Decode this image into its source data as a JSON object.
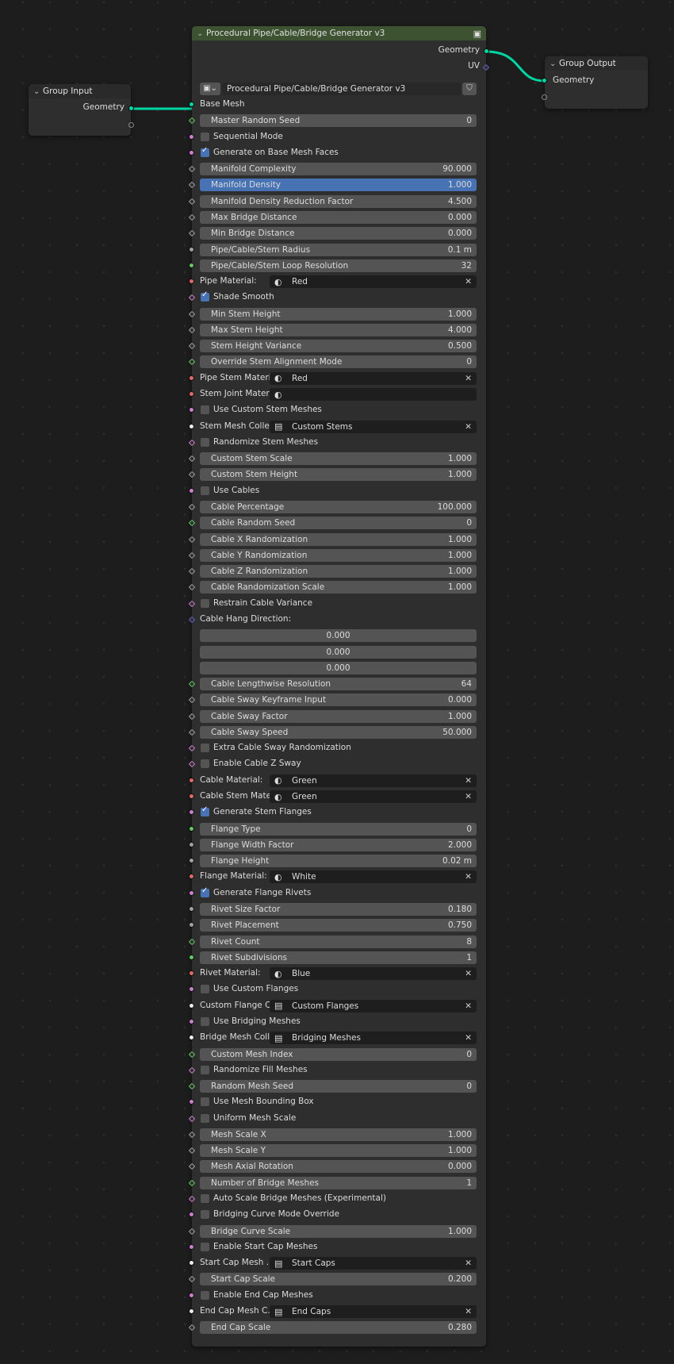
{
  "group_input": {
    "title": "Group Input",
    "outputs": [
      "Geometry"
    ]
  },
  "group_output": {
    "title": "Group Output",
    "inputs": [
      "Geometry"
    ]
  },
  "main_node": {
    "title": "Procedural Pipe/Cable/Bridge Generator v3",
    "tree_name": "Procedural Pipe/Cable/Bridge Generator v3",
    "outputs": [
      "Geometry",
      "UV"
    ],
    "rows": [
      {
        "kind": "plain",
        "label": "Base Mesh",
        "socket": "c-geo",
        "shape": "circle",
        "name": "base-mesh-socket-row"
      },
      {
        "kind": "field",
        "label": "Master Random Seed",
        "value": "0",
        "socket": "c-green",
        "shape": "diamond"
      },
      {
        "kind": "check",
        "label": "Sequential Mode",
        "checked": false,
        "socket": "c-pink",
        "shape": "circle"
      },
      {
        "kind": "check",
        "label": "Generate on Base Mesh Faces",
        "checked": true,
        "socket": "c-pink",
        "shape": "circle"
      },
      {
        "kind": "field",
        "label": "Manifold Complexity",
        "value": "90.000",
        "socket": "c-gray",
        "shape": "diamond"
      },
      {
        "kind": "field",
        "label": "Manifold Density",
        "value": "1.000",
        "socket": "c-gray",
        "shape": "diamond",
        "active": true
      },
      {
        "kind": "field",
        "label": "Manifold Density Reduction Factor",
        "value": "4.500",
        "socket": "c-gray",
        "shape": "diamond"
      },
      {
        "kind": "field",
        "label": "Max Bridge Distance",
        "value": "0.000",
        "socket": "c-gray",
        "shape": "diamond"
      },
      {
        "kind": "field",
        "label": "Min Bridge Distance",
        "value": "0.000",
        "socket": "c-gray",
        "shape": "diamond"
      },
      {
        "kind": "field",
        "label": "Pipe/Cable/Stem Radius",
        "value": "0.1 m",
        "socket": "c-gray",
        "shape": "circle"
      },
      {
        "kind": "field",
        "label": "Pipe/Cable/Stem Loop Resolution",
        "value": "32",
        "socket": "c-green",
        "shape": "circle"
      },
      {
        "kind": "select",
        "label": "Pipe Material:",
        "value": "Red",
        "icon": "material",
        "close": true,
        "socket": "c-red",
        "shape": "circle"
      },
      {
        "kind": "check",
        "label": "Shade Smooth",
        "checked": true,
        "socket": "c-pink",
        "shape": "diamond"
      },
      {
        "kind": "field",
        "label": "Min Stem Height",
        "value": "1.000",
        "socket": "c-gray",
        "shape": "diamond"
      },
      {
        "kind": "field",
        "label": "Max Stem Height",
        "value": "4.000",
        "socket": "c-gray",
        "shape": "diamond"
      },
      {
        "kind": "field",
        "label": "Stem Height Variance",
        "value": "0.500",
        "socket": "c-gray",
        "shape": "diamond"
      },
      {
        "kind": "field",
        "label": "Override Stem Alignment Mode",
        "value": "0",
        "socket": "c-green",
        "shape": "diamond"
      },
      {
        "kind": "select",
        "label": "Pipe Stem Materi",
        "value": "Red",
        "icon": "material",
        "close": true,
        "socket": "c-red",
        "shape": "circle"
      },
      {
        "kind": "select",
        "label": "Stem Joint Materi",
        "value": "",
        "icon": "material",
        "close": false,
        "socket": "c-red",
        "shape": "circle"
      },
      {
        "kind": "check",
        "label": "Use Custom Stem Meshes",
        "checked": false,
        "socket": "c-pink",
        "shape": "circle"
      },
      {
        "kind": "select",
        "label": "Stem Mesh Colle...",
        "value": "Custom Stems",
        "icon": "collection",
        "close": true,
        "socket": "c-white",
        "shape": "circle"
      },
      {
        "kind": "check",
        "label": "Randomize Stem Meshes",
        "checked": false,
        "socket": "c-pink",
        "shape": "diamond"
      },
      {
        "kind": "field",
        "label": "Custom Stem Scale",
        "value": "1.000",
        "socket": "c-gray",
        "shape": "diamond"
      },
      {
        "kind": "field",
        "label": "Custom Stem Height",
        "value": "1.000",
        "socket": "c-gray",
        "shape": "diamond"
      },
      {
        "kind": "check",
        "label": "Use Cables",
        "checked": false,
        "socket": "c-pink",
        "shape": "circle"
      },
      {
        "kind": "field",
        "label": "Cable Percentage",
        "value": "100.000",
        "socket": "c-gray",
        "shape": "diamond"
      },
      {
        "kind": "field",
        "label": "Cable Random Seed",
        "value": "0",
        "socket": "c-green",
        "shape": "diamond"
      },
      {
        "kind": "field",
        "label": "Cable X Randomization",
        "value": "1.000",
        "socket": "c-gray",
        "shape": "diamond"
      },
      {
        "kind": "field",
        "label": "Cable Y Randomization",
        "value": "1.000",
        "socket": "c-gray",
        "shape": "diamond"
      },
      {
        "kind": "field",
        "label": "Cable Z Randomization",
        "value": "1.000",
        "socket": "c-gray",
        "shape": "diamond"
      },
      {
        "kind": "field",
        "label": "Cable Randomization Scale",
        "value": "1.000",
        "socket": "c-gray",
        "shape": "diamond"
      },
      {
        "kind": "check",
        "label": "Restrain Cable Variance",
        "checked": false,
        "socket": "c-pink",
        "shape": "diamond"
      },
      {
        "kind": "plain",
        "label": "Cable Hang Direction:",
        "socket": "c-blue",
        "shape": "diamond",
        "name": "cable-hang-direction-label"
      },
      {
        "kind": "vec",
        "value": "0.000",
        "name": "cable-hang-direction-x"
      },
      {
        "kind": "vec",
        "value": "0.000",
        "name": "cable-hang-direction-y"
      },
      {
        "kind": "vec",
        "value": "0.000",
        "name": "cable-hang-direction-z"
      },
      {
        "kind": "field",
        "label": "Cable Lengthwise Resolution",
        "value": "64",
        "socket": "c-green",
        "shape": "diamond"
      },
      {
        "kind": "field",
        "label": "Cable Sway Keyframe Input",
        "value": "0.000",
        "socket": "c-gray",
        "shape": "diamond"
      },
      {
        "kind": "field",
        "label": "Cable Sway Factor",
        "value": "1.000",
        "socket": "c-gray",
        "shape": "diamond"
      },
      {
        "kind": "field",
        "label": "Cable Sway Speed",
        "value": "50.000",
        "socket": "c-gray",
        "shape": "diamond"
      },
      {
        "kind": "check",
        "label": "Extra Cable Sway Randomization",
        "checked": false,
        "socket": "c-pink",
        "shape": "diamond"
      },
      {
        "kind": "check",
        "label": "Enable Cable Z Sway",
        "checked": false,
        "socket": "c-pink",
        "shape": "diamond"
      },
      {
        "kind": "select",
        "label": "Cable Material:",
        "value": "Green",
        "icon": "material",
        "close": true,
        "socket": "c-red",
        "shape": "circle"
      },
      {
        "kind": "select",
        "label": "Cable Stem Mate",
        "value": "Green",
        "icon": "material",
        "close": true,
        "socket": "c-red",
        "shape": "circle"
      },
      {
        "kind": "check",
        "label": "Generate Stem Flanges",
        "checked": true,
        "socket": "c-pink",
        "shape": "circle"
      },
      {
        "kind": "field",
        "label": "Flange Type",
        "value": "0",
        "socket": "c-green",
        "shape": "circle"
      },
      {
        "kind": "field",
        "label": "Flange Width Factor",
        "value": "2.000",
        "socket": "c-gray",
        "shape": "circle"
      },
      {
        "kind": "field",
        "label": "Flange Height",
        "value": "0.02 m",
        "socket": "c-gray",
        "shape": "circle"
      },
      {
        "kind": "select",
        "label": "Flange Material:",
        "value": "White",
        "icon": "material",
        "close": true,
        "socket": "c-red",
        "shape": "circle"
      },
      {
        "kind": "check",
        "label": "Generate Flange Rivets",
        "checked": true,
        "socket": "c-pink",
        "shape": "circle"
      },
      {
        "kind": "field",
        "label": "Rivet Size Factor",
        "value": "0.180",
        "socket": "c-gray",
        "shape": "circle"
      },
      {
        "kind": "field",
        "label": "Rivet Placement",
        "value": "0.750",
        "socket": "c-gray",
        "shape": "circle"
      },
      {
        "kind": "field",
        "label": "Rivet Count",
        "value": "8",
        "socket": "c-green",
        "shape": "diamond"
      },
      {
        "kind": "field",
        "label": "Rivet Subdivisions",
        "value": "1",
        "socket": "c-green",
        "shape": "circle"
      },
      {
        "kind": "select",
        "label": "Rivet Material:",
        "value": "Blue",
        "icon": "material",
        "close": true,
        "socket": "c-red",
        "shape": "circle"
      },
      {
        "kind": "check",
        "label": "Use Custom Flanges",
        "checked": false,
        "socket": "c-pink",
        "shape": "circle"
      },
      {
        "kind": "select",
        "label": "Custom Flange C",
        "value": "Custom Flanges",
        "icon": "collection",
        "close": true,
        "socket": "c-white",
        "shape": "circle"
      },
      {
        "kind": "check",
        "label": "Use Bridging Meshes",
        "checked": false,
        "socket": "c-pink",
        "shape": "circle"
      },
      {
        "kind": "select",
        "label": "Bridge Mesh Coll...",
        "value": "Bridging Meshes",
        "icon": "collection",
        "close": true,
        "socket": "c-white",
        "shape": "circle"
      },
      {
        "kind": "field",
        "label": "Custom Mesh Index",
        "value": "0",
        "socket": "c-green",
        "shape": "diamond"
      },
      {
        "kind": "check",
        "label": "Randomize Fill Meshes",
        "checked": false,
        "socket": "c-pink",
        "shape": "diamond"
      },
      {
        "kind": "field",
        "label": "Random Mesh Seed",
        "value": "0",
        "socket": "c-green",
        "shape": "diamond"
      },
      {
        "kind": "check",
        "label": "Use Mesh Bounding Box",
        "checked": false,
        "socket": "c-pink",
        "shape": "circle"
      },
      {
        "kind": "check",
        "label": "Uniform Mesh Scale",
        "checked": false,
        "socket": "c-pink",
        "shape": "diamond"
      },
      {
        "kind": "field",
        "label": "Mesh Scale X",
        "value": "1.000",
        "socket": "c-gray",
        "shape": "diamond"
      },
      {
        "kind": "field",
        "label": "Mesh Scale Y",
        "value": "1.000",
        "socket": "c-gray",
        "shape": "diamond"
      },
      {
        "kind": "field",
        "label": "Mesh Axial Rotation",
        "value": "0.000",
        "socket": "c-gray",
        "shape": "diamond"
      },
      {
        "kind": "field",
        "label": "Number of Bridge Meshes",
        "value": "1",
        "socket": "c-green",
        "shape": "diamond"
      },
      {
        "kind": "check",
        "label": "Auto Scale Bridge Meshes (Experimental)",
        "checked": false,
        "socket": "c-pink",
        "shape": "diamond"
      },
      {
        "kind": "check",
        "label": "Bridging Curve Mode Override",
        "checked": false,
        "socket": "c-pink",
        "shape": "circle"
      },
      {
        "kind": "field",
        "label": "Bridge Curve Scale",
        "value": "1.000",
        "socket": "c-gray",
        "shape": "diamond"
      },
      {
        "kind": "check",
        "label": "Enable Start Cap Meshes",
        "checked": false,
        "socket": "c-pink",
        "shape": "circle"
      },
      {
        "kind": "select",
        "label": "Start Cap Mesh ...",
        "value": "Start Caps",
        "icon": "collection",
        "close": true,
        "socket": "c-white",
        "shape": "circle"
      },
      {
        "kind": "field",
        "label": "Start Cap Scale",
        "value": "0.200",
        "socket": "c-gray",
        "shape": "diamond"
      },
      {
        "kind": "check",
        "label": "Enable End Cap Meshes",
        "checked": false,
        "socket": "c-pink",
        "shape": "circle"
      },
      {
        "kind": "select",
        "label": "End Cap Mesh C...",
        "value": "End Caps",
        "icon": "collection",
        "close": true,
        "socket": "c-white",
        "shape": "circle"
      },
      {
        "kind": "field",
        "label": "End Cap Scale",
        "value": "0.280",
        "socket": "c-gray",
        "shape": "diamond"
      }
    ]
  },
  "colors": {
    "geometry_socket": "#00d6a3",
    "node_header_green": "#3c5230",
    "active_field": "#4772b3",
    "vector_socket": "#6363c7"
  }
}
